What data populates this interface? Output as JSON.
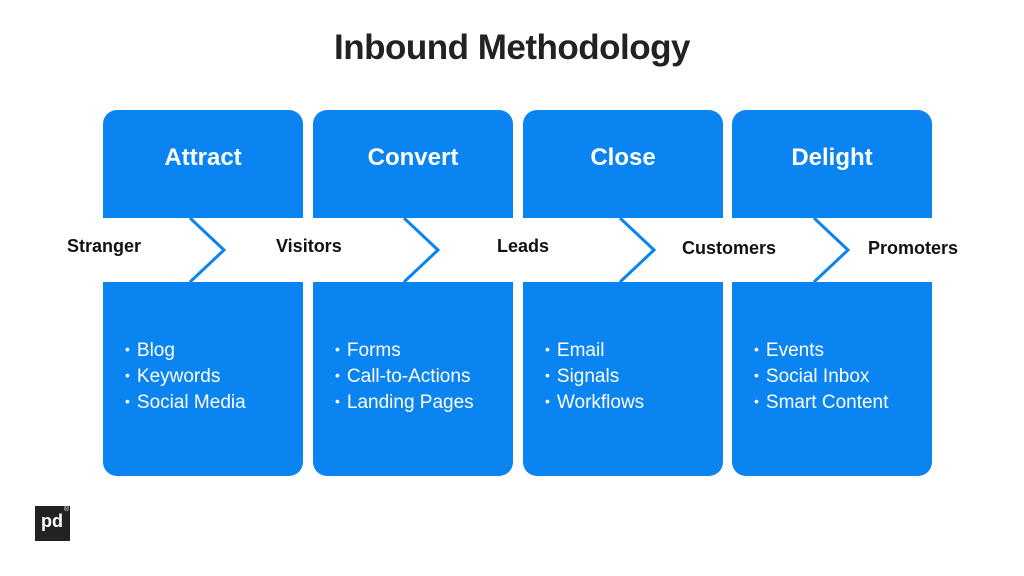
{
  "title": "Inbound Methodology",
  "colors": {
    "accent": "#0a84f0",
    "title": "#222222",
    "stage_text": "#111111"
  },
  "phases": [
    {
      "name": "Attract",
      "items": [
        "Blog",
        "Keywords",
        "Social Media"
      ]
    },
    {
      "name": "Convert",
      "items": [
        "Forms",
        "Call-to-Actions",
        "Landing Pages"
      ]
    },
    {
      "name": "Close",
      "items": [
        "Email",
        "Signals",
        "Workflows"
      ]
    },
    {
      "name": "Delight",
      "items": [
        "Events",
        "Social Inbox",
        "Smart Content"
      ]
    }
  ],
  "stages": [
    "Stranger",
    "Visitors",
    "Leads",
    "Customers",
    "Promoters"
  ],
  "logo": {
    "text": "pd",
    "mark": "®"
  }
}
